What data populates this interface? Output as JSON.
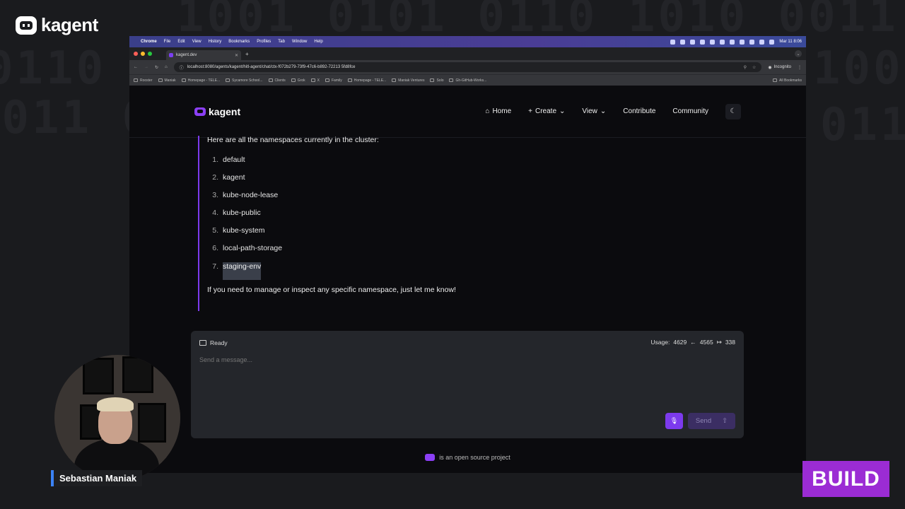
{
  "overlay": {
    "brand": "kagent",
    "presenter_name": "Sebastian Maniak",
    "event_badge": "BUILD",
    "accent_color": "#9b2cd4"
  },
  "macos": {
    "menu": [
      "Chrome",
      "File",
      "Edit",
      "View",
      "History",
      "Bookmarks",
      "Profiles",
      "Tab",
      "Window",
      "Help"
    ],
    "clock": "Mar 11  8:06"
  },
  "browser": {
    "tab_title": "kagent.dev",
    "url": "localhost:8080/agents/kagent/hitl-agent/chat/ctx-f072b279-73f9-47c6-b892-72213 5fd8fce",
    "incognito_label": "Incognito",
    "bookmarks": [
      "Rooster",
      "Maniak",
      "Homepage - TELE...",
      "Sycamore School...",
      "Clients",
      "Grok",
      "X",
      "Family",
      "Homepage - TELE...",
      "Maniak Ventures",
      "Solo",
      "Gh-GitHub-Works..."
    ],
    "all_bookmarks": "All Bookmarks"
  },
  "nav": {
    "logo": "kagent",
    "home": "Home",
    "create": "Create",
    "view": "View",
    "contribute": "Contribute",
    "community": "Community"
  },
  "message": {
    "intro": "Here are all the namespaces currently in the cluster:",
    "namespaces": [
      "default",
      "kagent",
      "kube-node-lease",
      "kube-public",
      "kube-system",
      "local-path-storage",
      "staging-env"
    ],
    "outro": "If you need to manage or inspect any specific namespace, just let me know!"
  },
  "composer": {
    "status": "Ready",
    "usage_label": "Usage:",
    "usage_total": "4629",
    "usage_in": "4565",
    "usage_out": "338",
    "placeholder": "Send a message...",
    "send_label": "Send"
  },
  "footer": {
    "text": "is an open source project"
  }
}
